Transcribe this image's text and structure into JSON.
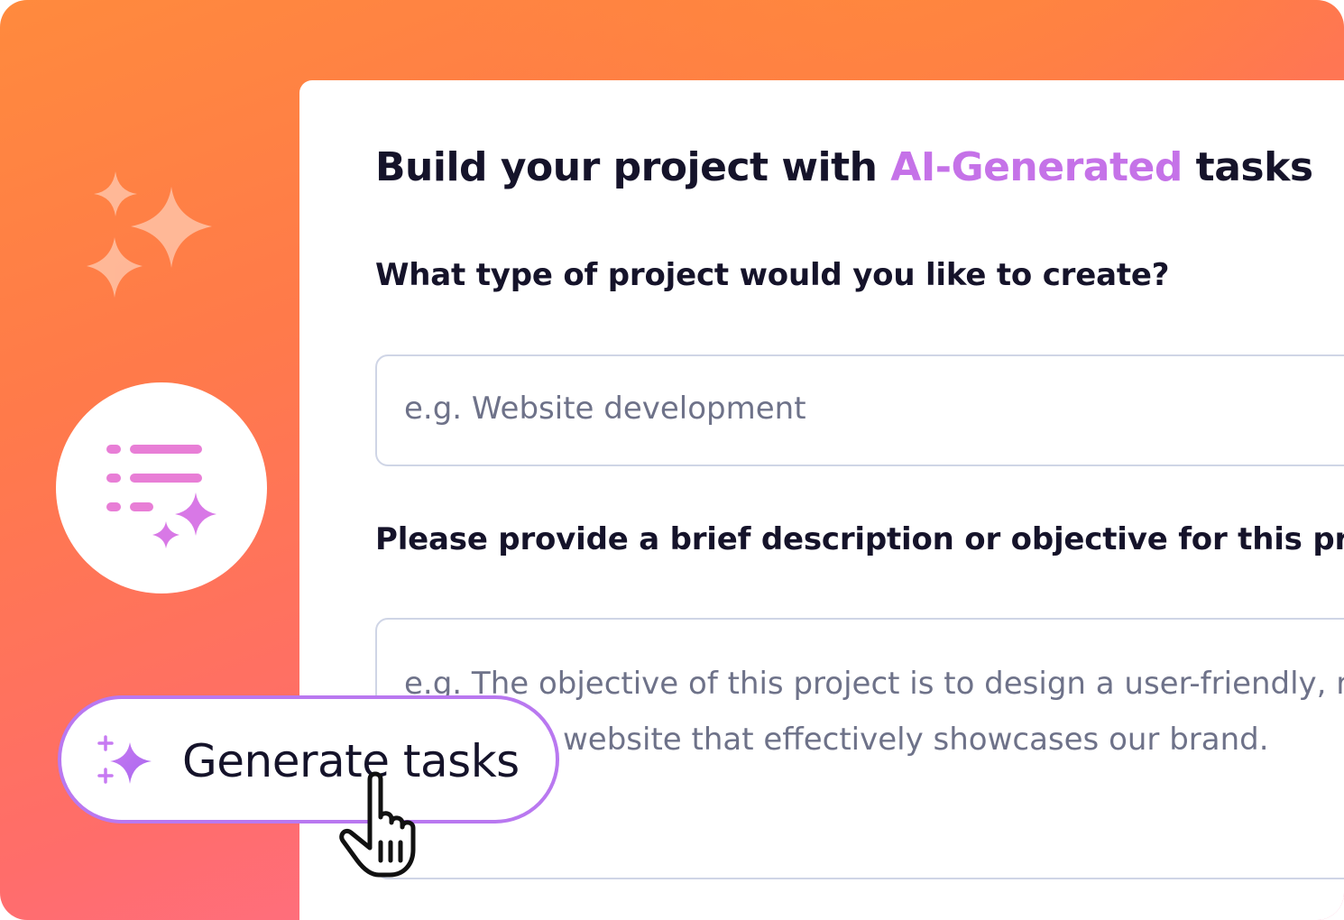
{
  "form": {
    "title_prefix": "Build your project with ",
    "title_accent": "AI-Generated",
    "title_suffix": " tasks",
    "question_type": "What type of project would you like to create?",
    "type_placeholder": "e.g. Website development",
    "question_description": "Please provide a brief description or objective for this project",
    "description_placeholder_line1": "e.g. The objective of this project is to design a user-friendly, r",
    "description_placeholder_line2": "website that effectively showcases our brand."
  },
  "button": {
    "label": "Generate tasks"
  },
  "icons": {
    "decorative_sparkles": "sparkles-icon",
    "task_list": "ai-task-list-icon",
    "button_icon": "sparkle-icon",
    "cursor": "hand-pointer-cursor-icon"
  },
  "colors": {
    "accent": "#c572e8",
    "button_border": "#b978f0",
    "background_orange": "#ff8a3d",
    "background_pink": "#ff6fa6",
    "text_dark": "#15132a",
    "placeholder": "#6e7289"
  }
}
